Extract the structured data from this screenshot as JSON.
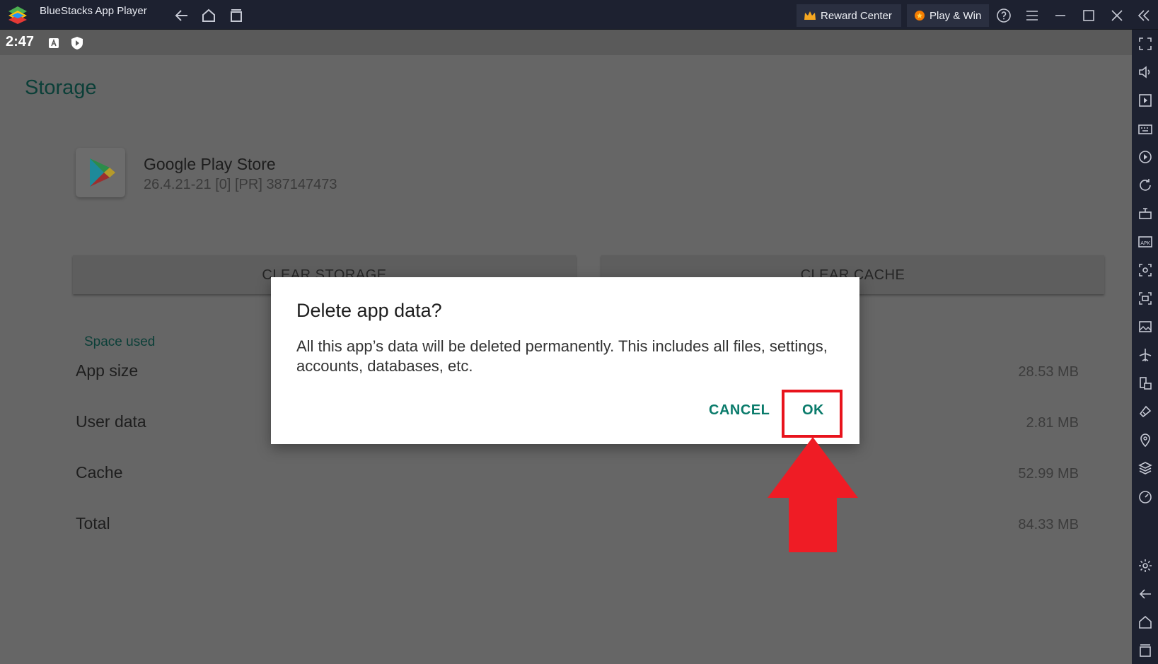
{
  "window": {
    "title": "BlueStacks App Player",
    "reward_center": "Reward Center",
    "play_win": "Play & Win"
  },
  "status_bar": {
    "time": "2:47"
  },
  "screen": {
    "title": "Storage",
    "app": {
      "name": "Google Play Store",
      "version": "26.4.21-21 [0] [PR] 387147473"
    },
    "buttons": {
      "clear_storage": "CLEAR STORAGE",
      "clear_cache": "CLEAR CACHE"
    },
    "section": "Space used",
    "rows": [
      {
        "label": "App size",
        "value": "28.53 MB"
      },
      {
        "label": "User data",
        "value": "2.81 MB"
      },
      {
        "label": "Cache",
        "value": "52.99 MB"
      },
      {
        "label": "Total",
        "value": "84.33 MB"
      }
    ]
  },
  "dialog": {
    "title": "Delete app data?",
    "body": "All this app’s data will be deleted permanently. This includes all files, settings, accounts, databases, etc.",
    "cancel": "CANCEL",
    "ok": "OK"
  },
  "colors": {
    "accent": "#0a7b6b",
    "highlight": "#e8131c",
    "chrome": "#1d2130"
  },
  "icons": {
    "titlebar": [
      "back-icon",
      "home-icon",
      "recents-icon",
      "crown-icon",
      "coin-icon",
      "help-icon",
      "menu-icon",
      "minimize-icon",
      "maximize-icon",
      "close-icon",
      "collapse-sidebar-icon"
    ],
    "sidebar": [
      "fullscreen-icon",
      "volume-icon",
      "media-icon",
      "keyboard-icon",
      "macro-icon",
      "rotate-icon",
      "game-controls-icon",
      "apk-install-icon",
      "screenshot-icon",
      "record-icon",
      "gallery-icon",
      "airplane-icon",
      "multi-instance-icon",
      "eco-mode-icon",
      "location-icon",
      "layers-icon",
      "performance-icon",
      "settings-icon",
      "back-icon",
      "home-icon",
      "recents-icon"
    ]
  }
}
